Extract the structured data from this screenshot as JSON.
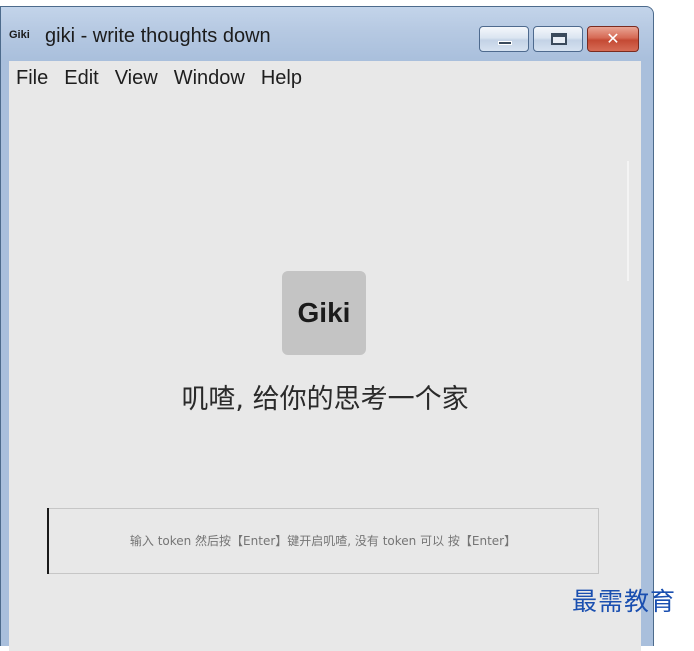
{
  "window": {
    "app_logo": "Giki",
    "title": "giki - write thoughts down",
    "buttons": {
      "minimize_icon": "minimize-icon",
      "maximize_icon": "maximize-icon",
      "close_glyph": "✕"
    }
  },
  "menu": {
    "items": [
      {
        "label": "File"
      },
      {
        "label": "Edit"
      },
      {
        "label": "View"
      },
      {
        "label": "Window"
      },
      {
        "label": "Help"
      }
    ]
  },
  "main": {
    "logo_text": "Giki",
    "tagline": "叽喳, 给你的思考一个家",
    "token_input": {
      "value": "",
      "placeholder": "输入 token 然后按【Enter】键开启叽喳, 没有 token 可以 按【Enter】"
    }
  },
  "watermark": "最需教育",
  "colors": {
    "client_bg": "#e8e8e8",
    "logo_bg": "#c4c4c4",
    "close_button": "#c44a34",
    "watermark": "#1a4fb0"
  }
}
